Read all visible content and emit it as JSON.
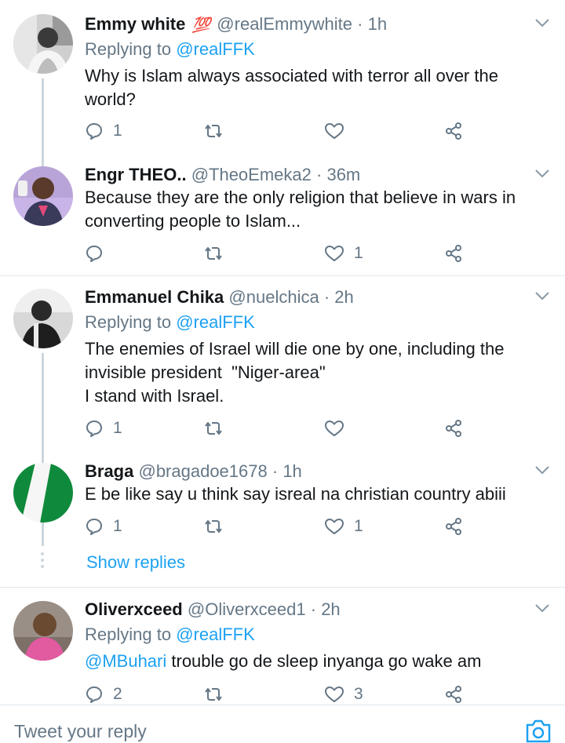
{
  "tweets": [
    {
      "name": "Emmy white",
      "emoji": "💯",
      "handle": "@realEmmywhite",
      "dot": "·",
      "time": "1h",
      "replying_prefix": "Replying to",
      "replying_to": "@realFFK",
      "text": "Why is Islam always associated with terror all over the world?",
      "reply_count": "1",
      "retweet_count": "",
      "like_count": ""
    },
    {
      "name": "Engr THEO..",
      "handle": "@TheoEmeka2",
      "dot": "·",
      "time": "36m",
      "text": "Because they are the only religion that believe in wars in converting people to Islam...",
      "reply_count": "",
      "retweet_count": "",
      "like_count": "1"
    },
    {
      "name": "Emmanuel Chika",
      "handle": "@nuelchica",
      "dot": "·",
      "time": "2h",
      "replying_prefix": "Replying to",
      "replying_to": "@realFFK",
      "text_line1": "The enemies of Israel will die one by one, including the",
      "text_line2": "invisible president  \"Niger-area\"",
      "text_line3": "I stand with Israel.",
      "reply_count": "1",
      "retweet_count": "",
      "like_count": ""
    },
    {
      "name": "Braga",
      "handle": "@bragadoe1678",
      "dot": "·",
      "time": "1h",
      "text": "E be like say u think say isreal na christian country abiii",
      "reply_count": "1",
      "retweet_count": "",
      "like_count": "1"
    },
    {
      "name": "Oliverxceed",
      "handle": "@Oliverxceed1",
      "dot": "·",
      "time": "2h",
      "replying_prefix": "Replying to",
      "replying_to": "@realFFK",
      "mention": "@MBuhari",
      "text": " trouble go de sleep inyanga go wake am",
      "reply_count": "2",
      "retweet_count": "",
      "like_count": "3"
    }
  ],
  "show_replies": "Show replies",
  "reply_bar": {
    "placeholder": "Tweet your reply"
  },
  "colors": {
    "accent": "#1da1f2",
    "muted": "#657786",
    "text": "#14171a",
    "line": "#ccd6dd"
  },
  "icons": [
    "reply-icon",
    "retweet-icon",
    "like-icon",
    "share-icon",
    "chevron-down-icon",
    "camera-icon"
  ]
}
